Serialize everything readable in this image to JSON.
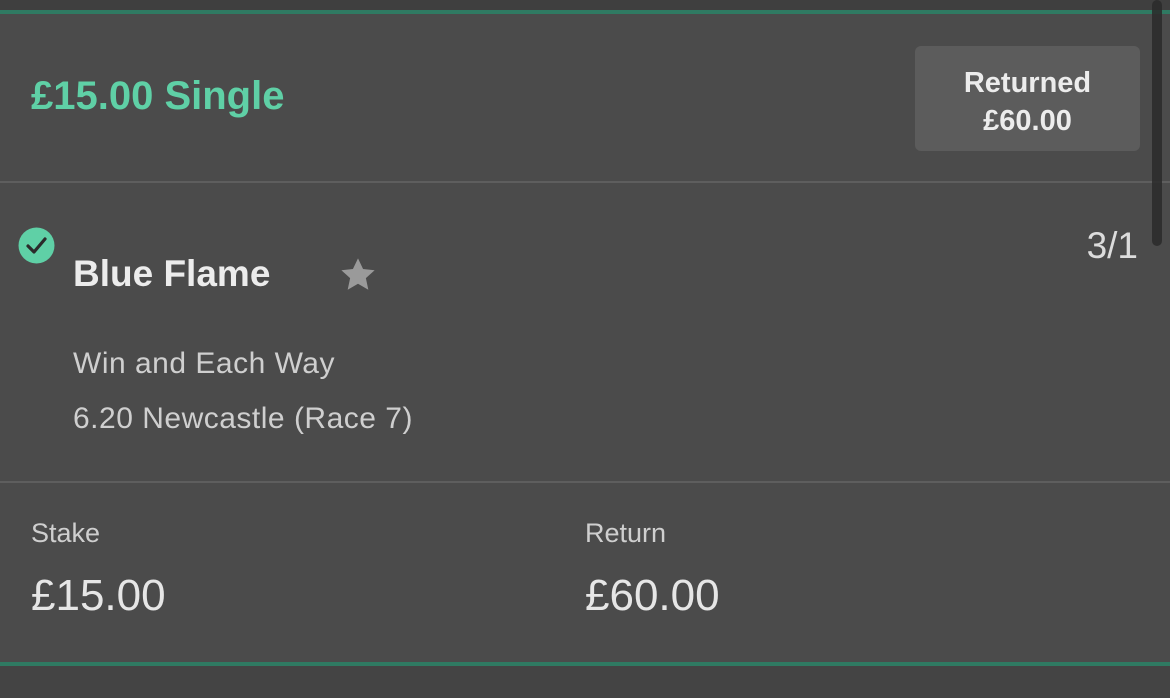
{
  "bet": {
    "title": "£15.00 Single",
    "status_label": "Returned",
    "status_amount": "£60.00"
  },
  "selection": {
    "name": "Blue Flame",
    "odds": "3/1",
    "market": "Win and Each Way",
    "event": "6.20 Newcastle (Race 7)",
    "result_icon": "check-circle-icon",
    "favourite_icon": "star-icon"
  },
  "summary": {
    "stake_label": "Stake",
    "stake_value": "£15.00",
    "return_label": "Return",
    "return_value": "£60.00"
  },
  "colors": {
    "background": "#4b4b4b",
    "accent": "#5fd0a6",
    "accent_line": "#2f7a62",
    "status_box": "#5c5c5c",
    "star": "#9a9a9a"
  }
}
